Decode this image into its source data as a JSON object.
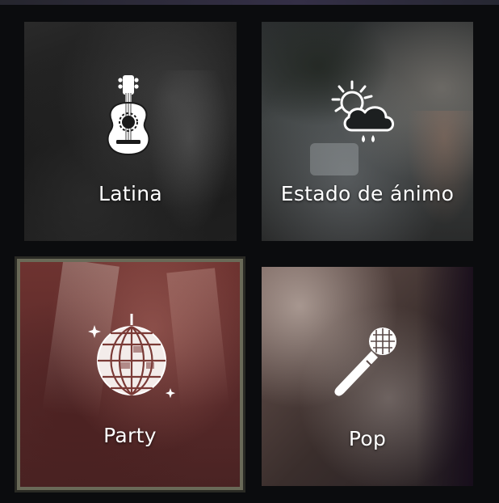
{
  "tiles": [
    {
      "id": "latina",
      "label": "Latina",
      "icon": "guitar-icon"
    },
    {
      "id": "estado",
      "label": "Estado de ánimo",
      "icon": "weather-icon"
    },
    {
      "id": "party",
      "label": "Party",
      "icon": "disco-ball-icon"
    },
    {
      "id": "pop",
      "label": "Pop",
      "icon": "microphone-icon"
    }
  ],
  "colors": {
    "background": "#0b0c0e",
    "label": "#ffffff",
    "selected_border": "#6a6a58",
    "party_tint": "#6e3330"
  }
}
